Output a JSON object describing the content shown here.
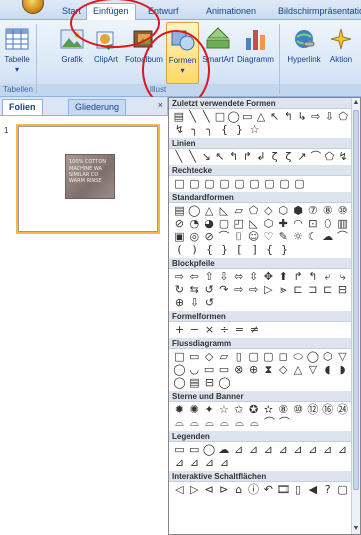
{
  "ribbon": {
    "tabs": [
      {
        "label": "Start"
      },
      {
        "label": "Einfügen"
      },
      {
        "label": "Entwurf"
      },
      {
        "label": "Animationen"
      },
      {
        "label": "Bildschirmpräsentatio"
      }
    ],
    "active_tab": "Einfügen",
    "buttons": {
      "table": "Tabelle",
      "picture": "Grafik",
      "clipart": "ClipArt",
      "photoalbum": "Fotoalbum",
      "shapes": "Formen",
      "smartart": "SmartArt",
      "chart": "Diagramm",
      "hyperlink": "Hyperlink",
      "action": "Aktion"
    },
    "groups": {
      "tables": "Tabellen",
      "illustrations": "Illust"
    }
  },
  "slides_pane": {
    "tabs": [
      "Folien",
      "Gliederung"
    ],
    "close_glyph": "×",
    "slide_number": "1",
    "label_lines": [
      "100% COTTON",
      "MACHINE WA",
      "SIMILAR CO",
      "WARM RINSE"
    ]
  },
  "gallery": {
    "sections": [
      {
        "title": "Zuletzt verwendete Formen",
        "rows": [
          [
            "▤",
            "╲",
            "╲",
            "□",
            "◯",
            "▭",
            "△",
            "↖",
            "↰",
            "↳",
            "⇨",
            "⇩",
            "⬠"
          ],
          [
            "↯",
            "╮",
            "╮",
            "{",
            "}",
            "☆"
          ]
        ]
      },
      {
        "title": "Linien",
        "rows": [
          [
            "╲",
            "╲",
            "↘",
            "↖",
            "↰",
            "↱",
            "↲",
            "ζ",
            "ζ",
            "↗",
            "⌒",
            "⬠",
            "↯"
          ]
        ]
      },
      {
        "title": "Rechtecke",
        "rows": [
          [
            "□",
            "▢",
            "▢",
            "▢",
            "▢",
            "▢",
            "▢",
            "▢",
            "▢"
          ]
        ]
      },
      {
        "title": "Standardformen",
        "rows": [
          [
            "▤",
            "◯",
            "△",
            "◺",
            "▱",
            "⬠",
            "◇",
            "⬡",
            "⬢",
            "⑦",
            "⑧",
            "⑩"
          ],
          [
            "⊘",
            "◔",
            "◕",
            "▢",
            "◰",
            "◺",
            "⬡",
            "✚",
            "◠",
            "⊡",
            "⬯",
            "▥"
          ],
          [
            "▣",
            "◎",
            "⊘",
            "⌒",
            "⌷",
            "☺",
            "♡",
            "✎",
            "☼",
            "☾",
            "☁",
            "⌒"
          ],
          [
            "(",
            ")",
            "{",
            "}",
            "[",
            "]",
            "{",
            "}"
          ]
        ]
      },
      {
        "title": "Blockpfeile",
        "rows": [
          [
            "⇨",
            "⇦",
            "⇧",
            "⇩",
            "⬄",
            "⇳",
            "✥",
            "⬆",
            "↱",
            "↰",
            "⤶",
            "⤷"
          ],
          [
            "↻",
            "⇆",
            "↺",
            "↷",
            "⇨",
            "⇨",
            "▷",
            "⪢",
            "⊏",
            "⊐",
            "⊏",
            "⊟"
          ],
          [
            "⊕",
            "⇩",
            "↺"
          ]
        ]
      },
      {
        "title": "Formelformen",
        "rows": [
          [
            "+",
            "−",
            "×",
            "÷",
            "=",
            "≠"
          ]
        ]
      },
      {
        "title": "Flussdiagramm",
        "rows": [
          [
            "□",
            "▭",
            "◇",
            "▱",
            "▯",
            "▢",
            "▢",
            "◻",
            "⬭",
            "◯",
            "⬡",
            "▽"
          ],
          [
            "◯",
            "◡",
            "▭",
            "▭",
            "⊗",
            "⊕",
            "⧗",
            "◇",
            "△",
            "▽",
            "◖",
            "◗"
          ],
          [
            "◯",
            "▤",
            "⊟",
            "◯"
          ]
        ]
      },
      {
        "title": "Sterne und Banner",
        "rows": [
          [
            "✹",
            "✺",
            "✦",
            "☆",
            "✩",
            "✪",
            "✫",
            "⑧",
            "⑩",
            "⑫",
            "⑯",
            "㉔"
          ],
          [
            "⌓",
            "⌓",
            "⌓",
            "⌓",
            "⌓",
            "⌓",
            "⌒",
            "⌒"
          ]
        ]
      },
      {
        "title": "Legenden",
        "rows": [
          [
            "▭",
            "▭",
            "◯",
            "☁",
            "⊿",
            "⊿",
            "⊿",
            "⊿",
            "⊿",
            "⊿",
            "⊿",
            "⊿"
          ],
          [
            "⊿",
            "⊿",
            "⊿",
            "⊿"
          ]
        ]
      },
      {
        "title": "Interaktive Schaltflächen",
        "rows": [
          [
            "◁",
            "▷",
            "⊲",
            "⊳",
            "⌂",
            "ⓘ",
            "↶",
            "🎞",
            "▯",
            "◀",
            "?",
            "▢"
          ]
        ]
      }
    ]
  }
}
